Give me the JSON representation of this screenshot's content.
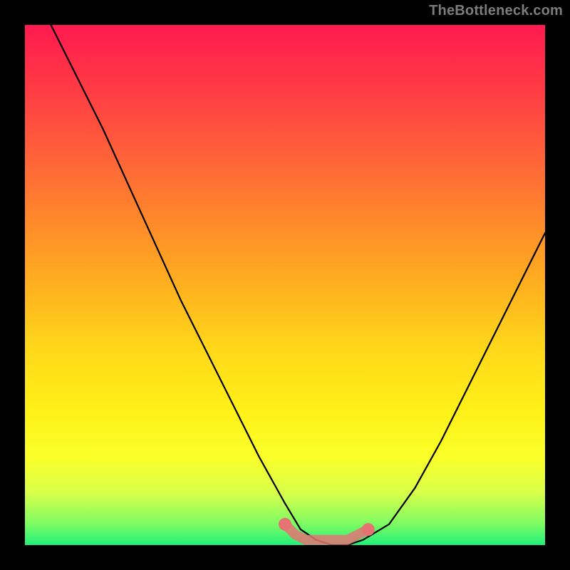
{
  "watermark": "TheBottleneck.com",
  "chart_data": {
    "type": "line",
    "title": "",
    "xlabel": "",
    "ylabel": "",
    "xlim": [
      0,
      100
    ],
    "ylim": [
      0,
      100
    ],
    "series": [
      {
        "name": "bottleneck-curve",
        "x": [
          5,
          10,
          15,
          20,
          25,
          30,
          35,
          40,
          45,
          50,
          53,
          56,
          59,
          62,
          65,
          70,
          75,
          80,
          85,
          90,
          95,
          100
        ],
        "y": [
          100,
          90,
          80,
          69,
          58,
          47,
          37,
          27,
          17,
          8,
          3,
          1,
          0,
          0,
          1,
          4,
          11,
          20,
          30,
          40,
          50,
          60
        ]
      },
      {
        "name": "optimal-band",
        "x": [
          50,
          52,
          54,
          56,
          58,
          60,
          62,
          64,
          66
        ],
        "y": [
          4,
          2,
          1,
          1,
          1,
          1,
          1,
          2,
          3
        ]
      }
    ],
    "colors": {
      "curve": "#000000",
      "optimal_band": "#e57373",
      "gradient_top": "#ff1a4f",
      "gradient_bottom": "#21f07a"
    }
  }
}
